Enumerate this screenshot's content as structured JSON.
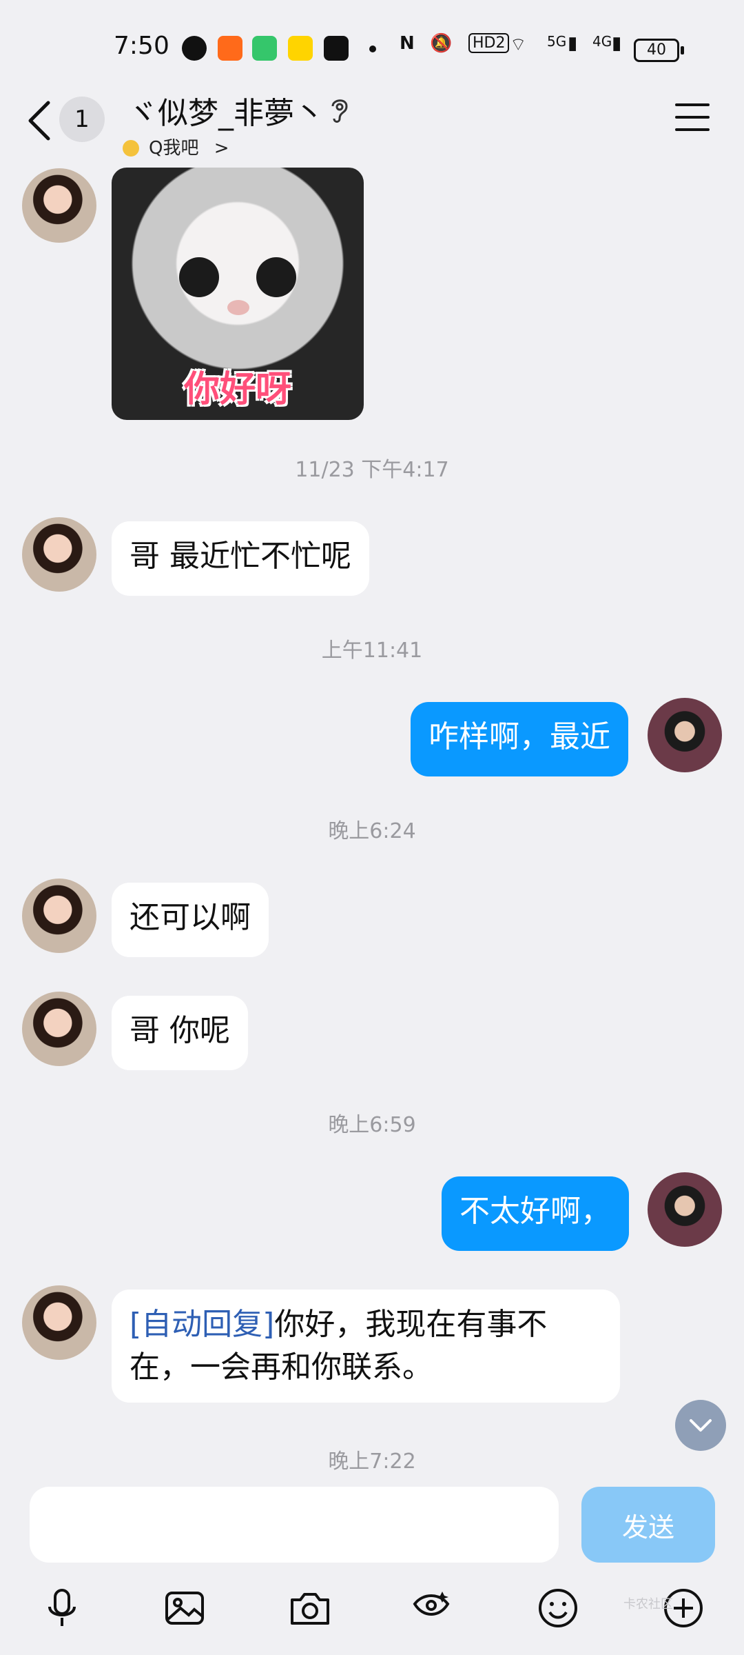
{
  "status_bar": {
    "time": "7:50",
    "network": "HD2",
    "signal_5g": "5G",
    "signal_4g": "4G",
    "battery": "40",
    "icons": [
      "wechat-icon",
      "app-icon",
      "video-icon",
      "game-icon",
      "tiktok-icon",
      "nfc-icon",
      "mute-icon",
      "wifi-icon"
    ]
  },
  "header": {
    "unread_count": "1",
    "contact_name": "ヾ似梦_非夢丶",
    "sub_status": "Q我吧",
    "sub_chevron": ">"
  },
  "chat": {
    "sticker_caption": "你好呀",
    "times": [
      "11/23 下午4:17",
      "上午11:41",
      "晚上6:24",
      "晚上6:59",
      "晚上7:22"
    ],
    "messages": [
      {
        "from": "her",
        "text": "哥 最近忙不忙呢"
      },
      {
        "from": "me",
        "text": "咋样啊，最近"
      },
      {
        "from": "her",
        "text": "还可以啊"
      },
      {
        "from": "her",
        "text": "哥 你呢"
      },
      {
        "from": "me",
        "text": "不太好啊，"
      },
      {
        "from": "her",
        "tag": "[自动回复]",
        "text": "你好，我现在有事不在，一会再和你联系。"
      }
    ]
  },
  "input": {
    "placeholder": "",
    "send_label": "发送"
  },
  "toolbar": {
    "items": [
      "mic-icon",
      "gallery-icon",
      "camera-icon",
      "redpacket-icon",
      "emoji-icon",
      "plus-icon"
    ]
  },
  "watermark": "卡农社区",
  "colors": {
    "background": "#f0f0f3",
    "outgoing_bubble": "#0a99ff",
    "incoming_bubble": "#ffffff",
    "send_button": "#88c8f7",
    "auto_reply_tag": "#2e5fb4"
  }
}
